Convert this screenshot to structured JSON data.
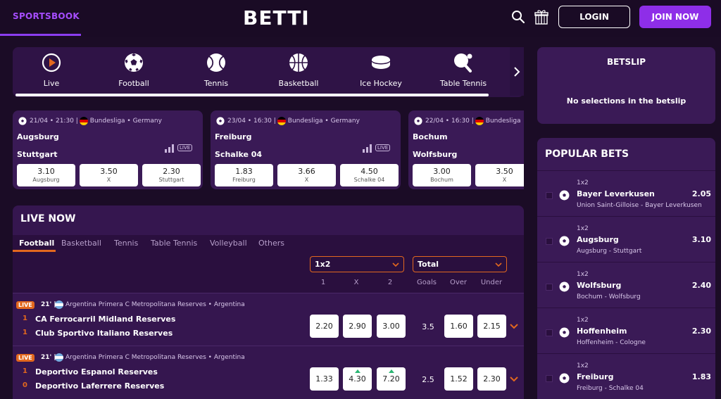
{
  "header": {
    "tab": "SPORTSBOOK",
    "logo": "BETTI",
    "login": "LOGIN",
    "join": "JOIN NOW"
  },
  "sports": [
    {
      "label": "Live",
      "icon": "live-icon"
    },
    {
      "label": "Football",
      "icon": "football-icon"
    },
    {
      "label": "Tennis",
      "icon": "tennis-icon"
    },
    {
      "label": "Basketball",
      "icon": "basketball-icon"
    },
    {
      "label": "Ice Hockey",
      "icon": "ice-hockey-icon"
    },
    {
      "label": "Table Tennis",
      "icon": "table-tennis-icon"
    }
  ],
  "featured": [
    {
      "meta": "21/04 • 21:30 |",
      "league": "Bundesliga • Germany",
      "team1": "Augsburg",
      "team2": "Stuttgart",
      "live": "LIVE",
      "odds": [
        {
          "v": "3.10",
          "n": "Augsburg"
        },
        {
          "v": "3.50",
          "n": "X"
        },
        {
          "v": "2.30",
          "n": "Stuttgart"
        }
      ]
    },
    {
      "meta": "23/04 • 16:30 |",
      "league": "Bundesliga • Germany",
      "team1": "Freiburg",
      "team2": "Schalke 04",
      "live": "LIVE",
      "odds": [
        {
          "v": "1.83",
          "n": "Freiburg"
        },
        {
          "v": "3.66",
          "n": "X"
        },
        {
          "v": "4.50",
          "n": "Schalke 04"
        }
      ]
    },
    {
      "meta": "22/04 • 16:30 |",
      "league": "Bundesliga",
      "team1": "Bochum",
      "team2": "Wolfsburg",
      "live": "",
      "odds": [
        {
          "v": "3.00",
          "n": "Bochum"
        },
        {
          "v": "3.50",
          "n": "X"
        }
      ]
    }
  ],
  "live_now": {
    "title": "LIVE NOW",
    "tabs": [
      "Football",
      "Basketball",
      "Tennis",
      "Table Tennis",
      "Volleyball",
      "Others"
    ],
    "market1": "1x2",
    "market2": "Total",
    "headers": [
      "1",
      "X",
      "2",
      "Goals",
      "Over",
      "Under"
    ],
    "matches": [
      {
        "badge": "LIVE",
        "minute": "21' |",
        "league": "Argentina Primera C Metropolitana Reserves • Argentina",
        "score1": "1",
        "team1": "CA Ferrocarril Midland Reserves",
        "score2": "1",
        "team2": "Club Sportivo Italiano Reserves",
        "odds": [
          "2.20",
          "2.90",
          "3.00"
        ],
        "goals": "3.5",
        "over": "1.60",
        "under": "2.15"
      },
      {
        "badge": "LIVE",
        "minute": "21' |",
        "league": "Argentina Primera C Metropolitana Reserves • Argentina",
        "score1": "1",
        "team1": "Deportivo Espanol Reserves",
        "score2": "0",
        "team2": "Deportivo Laferrere Reserves",
        "odds": [
          "1.33",
          "4.30",
          "7.20"
        ],
        "goals": "2.5",
        "over": "1.52",
        "under": "2.30"
      }
    ]
  },
  "betslip": {
    "title": "BETSLIP",
    "empty": "No selections in the betslip"
  },
  "popular": {
    "title": "POPULAR BETS",
    "items": [
      {
        "market": "1x2",
        "selection": "Bayer Leverkusen",
        "match": "Union Saint-Gilloise - Bayer Leverkusen",
        "odd": "2.05"
      },
      {
        "market": "1x2",
        "selection": "Augsburg",
        "match": "Augsburg - Stuttgart",
        "odd": "3.10"
      },
      {
        "market": "1x2",
        "selection": "Wolfsburg",
        "match": "Bochum - Wolfsburg",
        "odd": "2.40"
      },
      {
        "market": "1x2",
        "selection": "Hoffenheim",
        "match": "Hoffenheim - Cologne",
        "odd": "2.30"
      },
      {
        "market": "1x2",
        "selection": "Freiburg",
        "match": "Freiburg - Schalke 04",
        "odd": "1.83"
      }
    ]
  },
  "colors": {
    "accent": "#8e2ee8",
    "orange": "#e2681e",
    "panel": "#3a1a56",
    "background": "#1b0c26"
  }
}
